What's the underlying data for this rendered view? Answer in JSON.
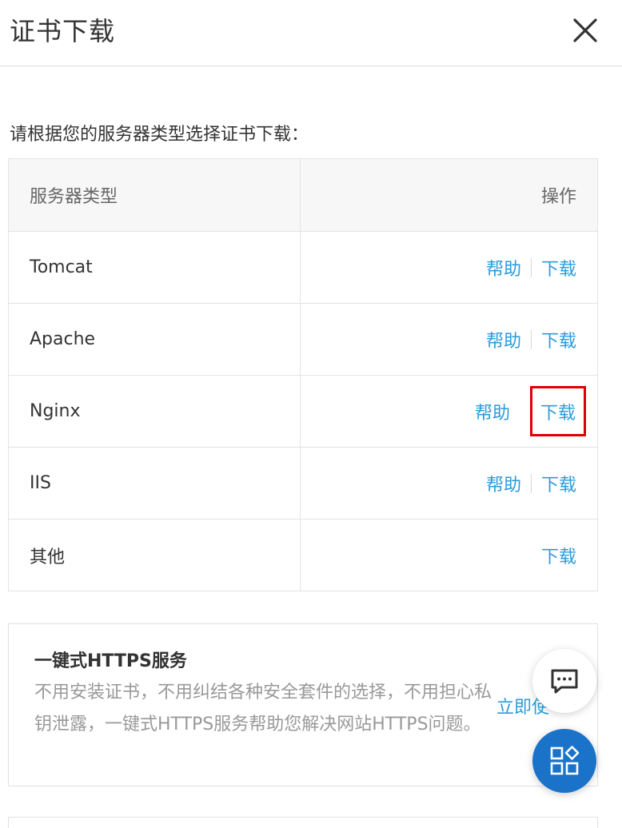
{
  "header": {
    "title": "证书下载",
    "close_icon": "close-icon"
  },
  "intro": "请根据您的服务器类型选择证书下载：",
  "table": {
    "headers": {
      "type": "服务器类型",
      "operation": "操作"
    },
    "rows": [
      {
        "type": "Tomcat",
        "help": "帮助",
        "download": "下载"
      },
      {
        "type": "Apache",
        "help": "帮助",
        "download": "下载"
      },
      {
        "type": "Nginx",
        "help": "帮助",
        "download": "下载"
      },
      {
        "type": "IIS",
        "help": "帮助",
        "download": "下载"
      },
      {
        "type": "其他",
        "download": "下载"
      }
    ]
  },
  "promo": {
    "title": "一键式HTTPS服务",
    "description": "不用安装证书，不用纠结各种安全套件的选择，不用担心私钥泄露，一键式HTTPS服务帮助您解决网站HTTPS问题。",
    "action": "立即使"
  },
  "floating": {
    "chat_icon": "chat-icon",
    "apps_icon": "apps-icon"
  },
  "colors": {
    "link": "#2a9cdb",
    "highlight": "#e00000",
    "fab": "#1a73c9"
  }
}
